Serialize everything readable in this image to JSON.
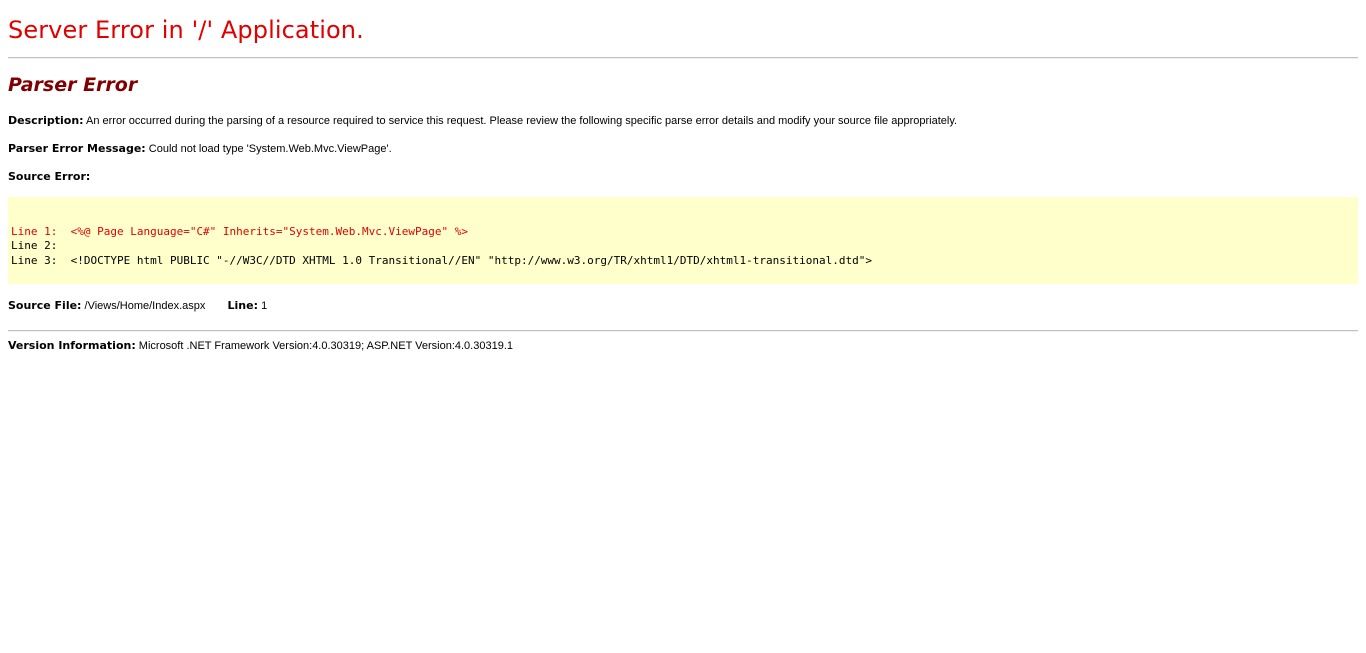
{
  "header": {
    "title": "Server Error in '/' Application.",
    "subtitle": "Parser Error"
  },
  "description": {
    "label": "Description:",
    "text": "An error occurred during the parsing of a resource required to service this request. Please review the following specific parse error details and modify your source file appropriately."
  },
  "parser_error_message": {
    "label": "Parser Error Message:",
    "text": "Could not load type 'System.Web.Mvc.ViewPage'."
  },
  "source_error": {
    "label": "Source Error:",
    "lines": [
      {
        "number": "Line 1:",
        "code": "<%@ Page Language=\"C#\" Inherits=\"System.Web.Mvc.ViewPage\" %>",
        "highlighted": true
      },
      {
        "number": "Line 2:",
        "code": "",
        "highlighted": false
      },
      {
        "number": "Line 3:",
        "code": "<!DOCTYPE html PUBLIC \"-//W3C//DTD XHTML 1.0 Transitional//EN\" \"http://www.w3.org/TR/xhtml1/DTD/xhtml1-transitional.dtd\">",
        "highlighted": false
      }
    ]
  },
  "source_file": {
    "label": "Source File:",
    "path": "/Views/Home/Index.aspx",
    "line_label": "Line:",
    "line_value": "1"
  },
  "version_information": {
    "label": "Version Information:",
    "text": "Microsoft .NET Framework Version:4.0.30319; ASP.NET Version:4.0.30319.1"
  },
  "colors": {
    "title": "#e00000",
    "subtitle": "#800000",
    "code_background": "#ffffcc",
    "error_line": "#e00000"
  }
}
